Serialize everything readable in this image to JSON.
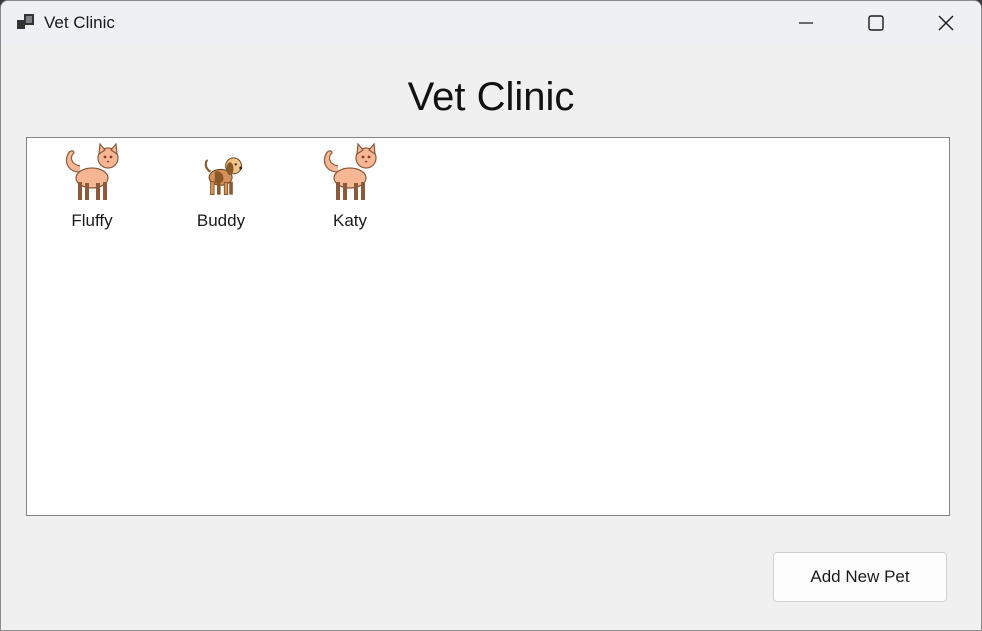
{
  "window": {
    "title": "Vet Clinic",
    "app_icon": "app-window-icon",
    "controls": [
      "minimize-icon",
      "maximize-icon",
      "close-icon"
    ]
  },
  "main": {
    "heading": "Vet Clinic",
    "pets": [
      {
        "name": "Fluffy",
        "icon": "cat-icon"
      },
      {
        "name": "Buddy",
        "icon": "dog-icon"
      },
      {
        "name": "Katy",
        "icon": "cat-icon"
      }
    ],
    "add_button_label": "Add New Pet"
  },
  "colors": {
    "window_bg": "#f0f0f0",
    "titlebar_bg": "#eef0f4",
    "list_bg": "#ffffff",
    "cat_fur": "#f7b795",
    "cat_legs": "#8b5a3c",
    "dog_fur": "#d4915a",
    "dog_dark": "#8b5a2b"
  }
}
